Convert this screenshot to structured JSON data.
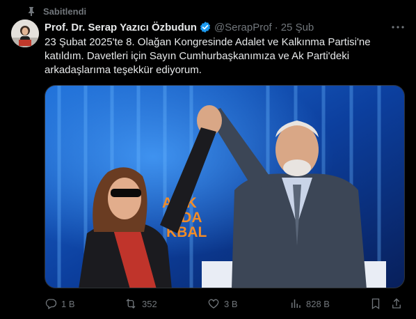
{
  "pinned": {
    "label": "Sabitlendi",
    "icon": "pin-icon"
  },
  "author": {
    "display_name": "Prof. Dr. Serap Yazıcı Özbudun",
    "handle": "@SerapProf",
    "separator": "·",
    "date": "25 Şub",
    "verified_icon": "verified-badge-icon",
    "verified_color": "#1d9bf0"
  },
  "tweet": {
    "text": "23 Şubat 2025'te 8. Olağan Kongresinde Adalet ve Kalkınma Partisi'ne\nkatıldım. Davetleri için Sayın Cumhurbaşkanımıza ve Ak Parti'deki\narkadaşlarıma teşekkür ediyorum."
  },
  "media": {
    "backdrop_lines": [
      "A AK",
      "NDA",
      "KBAL"
    ],
    "backdrop_text_color": "#f28c28"
  },
  "actions": {
    "reply": {
      "count": "1 B",
      "icon": "reply-icon"
    },
    "retweet": {
      "count": "352",
      "icon": "retweet-icon"
    },
    "like": {
      "count": "3 B",
      "icon": "heart-icon"
    },
    "views": {
      "count": "828 B",
      "icon": "views-icon"
    },
    "bookmark": {
      "icon": "bookmark-icon"
    },
    "share": {
      "icon": "share-icon"
    }
  },
  "colors": {
    "background": "#000000",
    "text": "#e7e9ea",
    "muted": "#71767b",
    "accent": "#1d9bf0"
  }
}
